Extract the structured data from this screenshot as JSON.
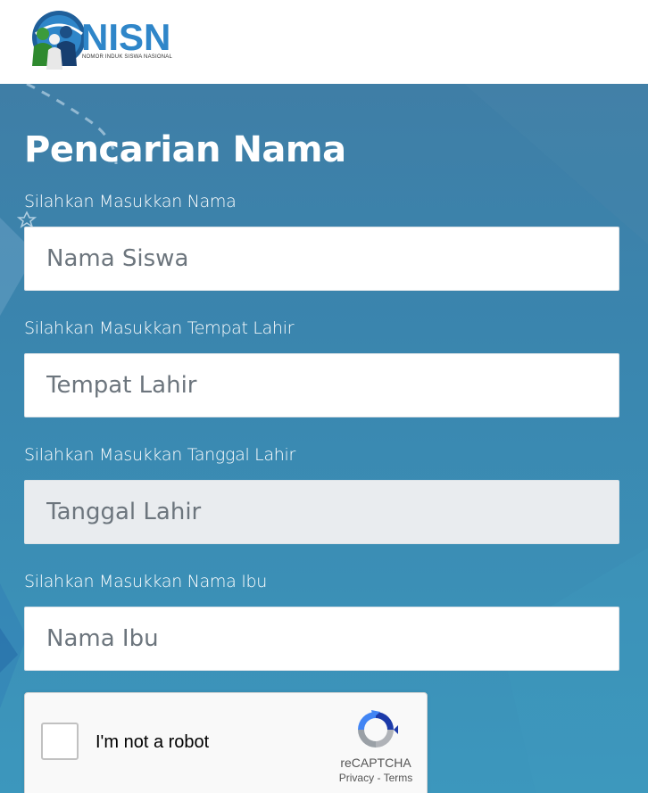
{
  "header": {
    "logo_text": "NISN",
    "logo_subtitle": "NOMOR INDUK SISWA NASIONAL"
  },
  "form": {
    "title": "Pencarian Nama",
    "fields": [
      {
        "label": "Silahkan Masukkan Nama",
        "placeholder": "Nama Siswa",
        "value": ""
      },
      {
        "label": "Silahkan Masukkan Tempat Lahir",
        "placeholder": "Tempat Lahir",
        "value": ""
      },
      {
        "label": "Silahkan Masukkan Tanggal Lahir",
        "placeholder": "Tanggal Lahir",
        "value": ""
      },
      {
        "label": "Silahkan Masukkan Nama Ibu",
        "placeholder": "Nama Ibu",
        "value": ""
      }
    ]
  },
  "captcha": {
    "label": "I'm not a robot",
    "brand": "reCAPTCHA",
    "privacy": "Privacy",
    "separator": " - ",
    "terms": "Terms"
  },
  "colors": {
    "main_bg": "#3a85ae",
    "logo_blue": "#2f86c9",
    "input_readonly_bg": "#e9ecef"
  }
}
